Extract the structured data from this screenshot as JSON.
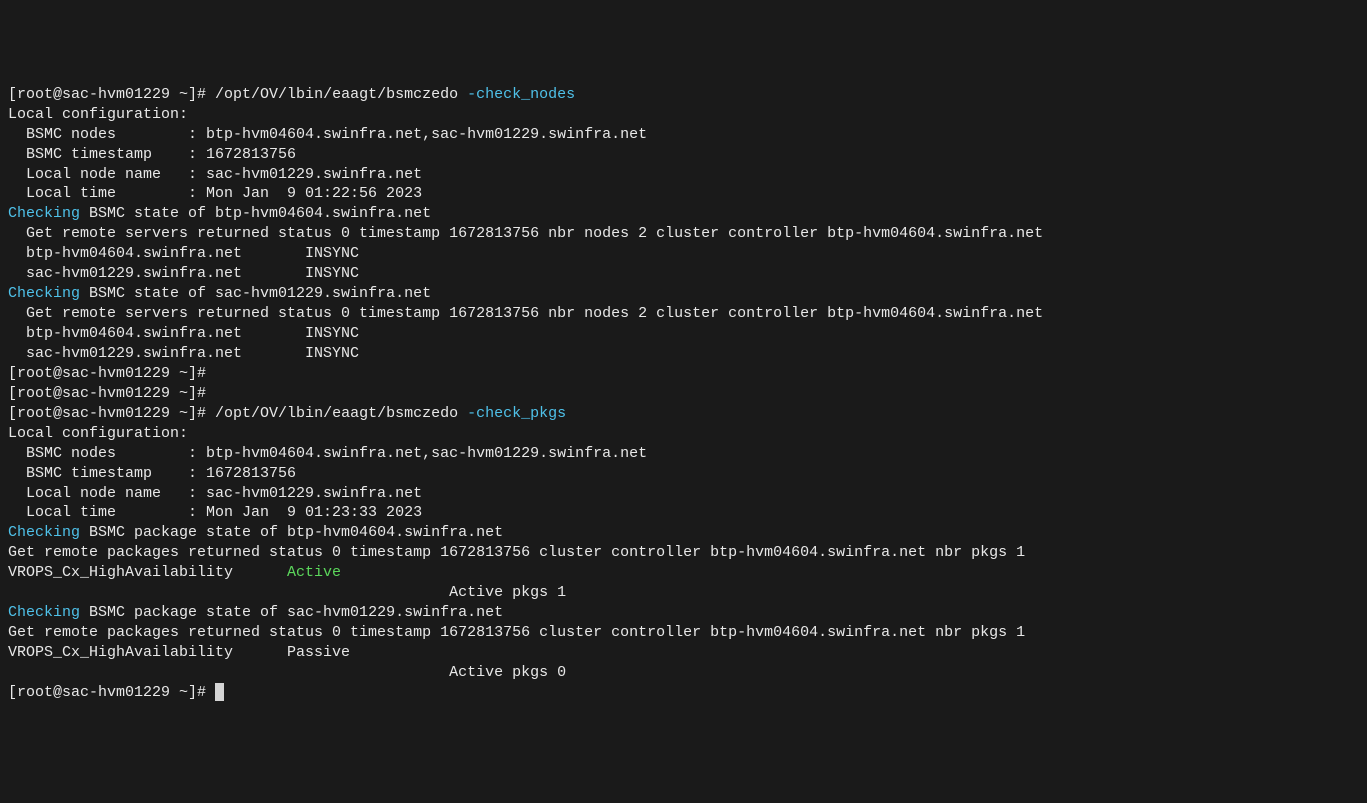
{
  "prompt1_prefix": "[root@sac-hvm01229 ~]# ",
  "cmd1_path": "/opt/OV/lbin/eaagt/bsmczedo ",
  "cmd1_arg": "-check_nodes",
  "local_config_header": "Local configuration:",
  "bsmc_nodes_line": "  BSMC nodes        : btp-hvm04604.swinfra.net,sac-hvm01229.swinfra.net",
  "bsmc_ts_line1": "  BSMC timestamp    : 1672813756",
  "local_node_line": "  Local node name   : sac-hvm01229.swinfra.net",
  "local_time_line1": "  Local time        : Mon Jan  9 01:22:56 2023",
  "blank": "",
  "checking_label": "Checking",
  "check1_rest": " BSMC state of btp-hvm04604.swinfra.net",
  "check1_status": "  Get remote servers returned status 0 timestamp 1672813756 nbr nodes 2 cluster controller btp-hvm04604.swinfra.net",
  "check1_n1": "  btp-hvm04604.swinfra.net       INSYNC",
  "check1_n2": "  sac-hvm01229.swinfra.net       INSYNC",
  "check2_rest": " BSMC state of sac-hvm01229.swinfra.net",
  "check2_status": "  Get remote servers returned status 0 timestamp 1672813756 nbr nodes 2 cluster controller btp-hvm04604.swinfra.net",
  "check2_n1": "  btp-hvm04604.swinfra.net       INSYNC",
  "check2_n2": "  sac-hvm01229.swinfra.net       INSYNC",
  "prompt2": "[root@sac-hvm01229 ~]#",
  "prompt3": "[root@sac-hvm01229 ~]#",
  "prompt4_prefix": "[root@sac-hvm01229 ~]# ",
  "cmd2_path": "/opt/OV/lbin/eaagt/bsmczedo ",
  "cmd2_arg": "-check_pkgs",
  "bsmc_ts_line2": "  BSMC timestamp    : 1672813756",
  "local_time_line2": "  Local time        : Mon Jan  9 01:23:33 2023",
  "pkg1_rest": " BSMC package state of btp-hvm04604.swinfra.net",
  "pkg1_status": "Get remote packages returned status 0 timestamp 1672813756 cluster controller btp-hvm04604.swinfra.net nbr pkgs 1",
  "pkg1_name": "VROPS_Cx_HighAvailability      ",
  "pkg1_state": "Active",
  "pkg1_summary": "                                                 Active pkgs 1",
  "pkg2_rest": " BSMC package state of sac-hvm01229.swinfra.net",
  "pkg2_status": "Get remote packages returned status 0 timestamp 1672813756 cluster controller btp-hvm04604.swinfra.net nbr pkgs 1",
  "pkg2_name": "VROPS_Cx_HighAvailability      Passive",
  "pkg2_summary": "                                                 Active pkgs 0",
  "prompt5": "[root@sac-hvm01229 ~]# "
}
